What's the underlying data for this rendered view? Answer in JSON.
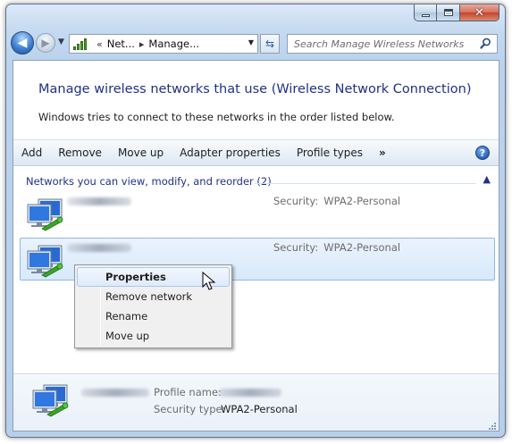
{
  "window": {
    "close_symbol": "✕"
  },
  "nav": {
    "back_symbol": "◀",
    "forward_symbol": "▶",
    "recent_symbol": "▼",
    "address": {
      "prefix": "«",
      "segments": [
        "Net...",
        "Manage..."
      ],
      "separator": "▸",
      "dropdown_symbol": "▼"
    },
    "refresh_symbol": "⇆",
    "search_placeholder": "Search Manage Wireless Networks"
  },
  "page": {
    "title": "Manage wireless networks that use (Wireless Network Connection)",
    "description": "Windows tries to connect to these networks in the order listed below."
  },
  "toolbar": {
    "add": "Add",
    "remove": "Remove",
    "move_up": "Move up",
    "adapter_properties": "Adapter properties",
    "profile_types": "Profile types",
    "more": "»",
    "help": "?"
  },
  "networks": {
    "group_header": "Networks you can view, modify, and reorder (2)",
    "collapse_symbol": "▲",
    "items": [
      {
        "security_label": "Security:",
        "security_value": "WPA2-Personal"
      },
      {
        "security_label": "Security:",
        "security_value": "WPA2-Personal"
      }
    ]
  },
  "context_menu": {
    "items": [
      {
        "label": "Properties"
      },
      {
        "label": "Remove network"
      },
      {
        "label": "Rename"
      },
      {
        "label": "Move up"
      }
    ]
  },
  "details": {
    "profile_name_label": "Profile name:",
    "security_type_label": "Security type:",
    "security_type_value": "WPA2-Personal"
  },
  "icons": {
    "network": "wireless-network-icon",
    "signal": "signal-bars-icon",
    "search": "search-icon",
    "help": "help-icon",
    "cursor": "mouse-pointer-icon"
  }
}
